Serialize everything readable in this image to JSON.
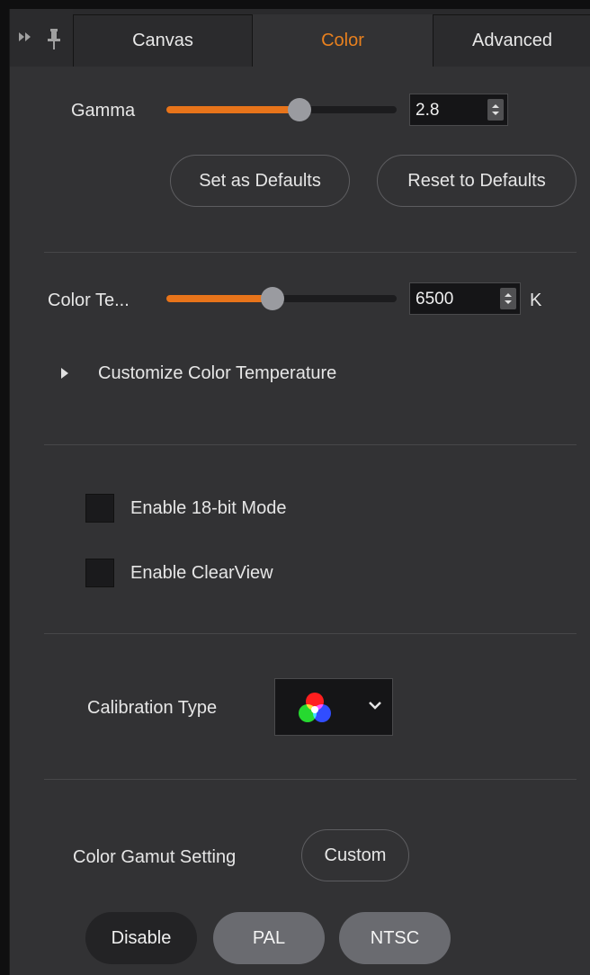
{
  "tabs": {
    "canvas": "Canvas",
    "color": "Color",
    "advanced": "Advanced",
    "active": "Color"
  },
  "gamma": {
    "label": "Gamma",
    "value": "2.8",
    "slider_fraction": 0.58
  },
  "defaults": {
    "set_label": "Set as Defaults",
    "reset_label": "Reset to Defaults"
  },
  "color_temperature": {
    "label": "Color Te...",
    "value": "6500",
    "unit": "K",
    "slider_fraction": 0.46,
    "customize_label": "Customize Color Temperature"
  },
  "options": {
    "enable_18bit_label": "Enable 18-bit Mode",
    "enable_18bit_checked": false,
    "enable_clearview_label": "Enable ClearView",
    "enable_clearview_checked": false
  },
  "calibration": {
    "label": "Calibration Type",
    "selected_icon": "rgb-circles-icon"
  },
  "gamut": {
    "label": "Color Gamut Setting",
    "custom_label": "Custom",
    "modes": [
      "Disable",
      "PAL",
      "NTSC"
    ],
    "selected_mode": "Disable"
  },
  "colors": {
    "accent": "#e8741a",
    "active_tab_text": "#e8801e",
    "panel_bg": "#323234"
  }
}
